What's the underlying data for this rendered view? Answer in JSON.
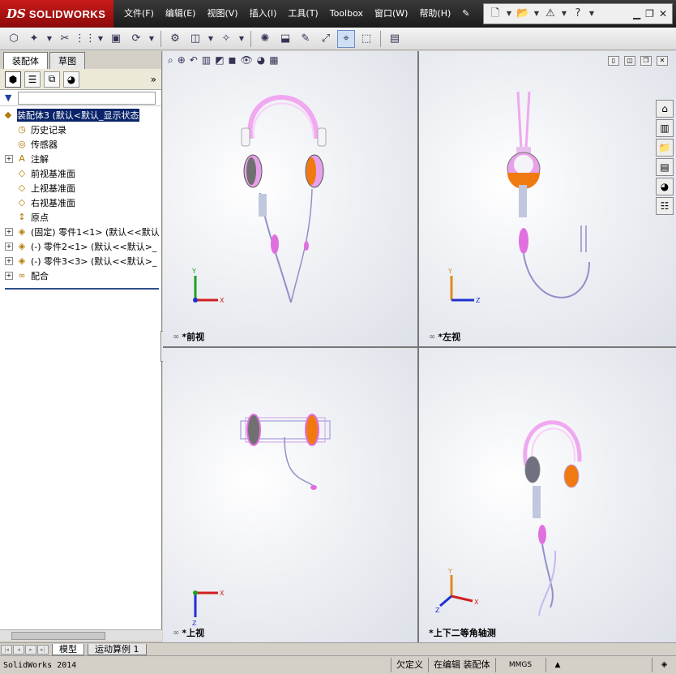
{
  "app": {
    "logo_ds": "DS",
    "logo_name": "SOLIDWORKS"
  },
  "menu": [
    {
      "id": "file",
      "label": "文件(F)"
    },
    {
      "id": "edit",
      "label": "编辑(E)"
    },
    {
      "id": "view",
      "label": "视图(V)"
    },
    {
      "id": "insert",
      "label": "插入(I)"
    },
    {
      "id": "tools",
      "label": "工具(T)"
    },
    {
      "id": "toolbox",
      "label": "Toolbox"
    },
    {
      "id": "window",
      "label": "窗口(W)"
    },
    {
      "id": "help",
      "label": "帮助(H)"
    }
  ],
  "left_panel": {
    "tabs": [
      {
        "label": "装配体",
        "active": true
      },
      {
        "label": "草图",
        "active": false
      }
    ],
    "more_glyph": "»",
    "tree": [
      {
        "label": "装配体3  (默认<默认_显示状态",
        "icon": "assembly-icon",
        "glyph": "◆",
        "expand": "",
        "selected": true
      },
      {
        "label": "历史记录",
        "icon": "history-icon",
        "glyph": "◷",
        "expand": "none",
        "selected": false
      },
      {
        "label": "传感器",
        "icon": "sensor-icon",
        "glyph": "◎",
        "expand": "none",
        "selected": false
      },
      {
        "label": "注解",
        "icon": "annotation-icon",
        "glyph": "A",
        "expand": "+",
        "selected": false
      },
      {
        "label": "前视基准面",
        "icon": "plane-icon",
        "glyph": "◇",
        "expand": "none",
        "selected": false
      },
      {
        "label": "上视基准面",
        "icon": "plane-icon",
        "glyph": "◇",
        "expand": "none",
        "selected": false
      },
      {
        "label": "右视基准面",
        "icon": "plane-icon",
        "glyph": "◇",
        "expand": "none",
        "selected": false
      },
      {
        "label": "原点",
        "icon": "origin-icon",
        "glyph": "↕",
        "expand": "none",
        "selected": false
      },
      {
        "label": "(固定) 零件1<1> (默认<<默认",
        "icon": "part-icon",
        "glyph": "◈",
        "expand": "+",
        "selected": false
      },
      {
        "label": "(-) 零件2<1> (默认<<默认>_",
        "icon": "part-icon",
        "glyph": "◈",
        "expand": "+",
        "selected": false
      },
      {
        "label": "(-) 零件3<3> (默认<<默认>_",
        "icon": "part-icon",
        "glyph": "◈",
        "expand": "+",
        "selected": false
      },
      {
        "label": "配合",
        "icon": "mates-icon",
        "glyph": "∞",
        "expand": "+",
        "selected": false
      }
    ]
  },
  "viewports": {
    "front": {
      "label": "*前视"
    },
    "left": {
      "label": "*左视"
    },
    "top": {
      "label": "*上视"
    },
    "iso": {
      "label": "*上下二等角轴测"
    }
  },
  "axes": {
    "x": "X",
    "y": "Y",
    "z": "Z"
  },
  "bottom_tabs": [
    {
      "label": "模型",
      "active": true
    },
    {
      "label": "运动算例 1",
      "active": false
    }
  ],
  "status": {
    "app_version": "SolidWorks 2014",
    "definition": "欠定义",
    "editing": "在编辑 装配体",
    "units": "MMGS",
    "arrow": "▲"
  },
  "colors": {
    "logo_red": "#c81b1b",
    "headset_pink": "#f0a8f0",
    "ear_orange": "#f07a10",
    "axis_x": "#d02020",
    "axis_y": "#20a020",
    "axis_z": "#2030d0",
    "axis_orange": "#e08a20"
  }
}
